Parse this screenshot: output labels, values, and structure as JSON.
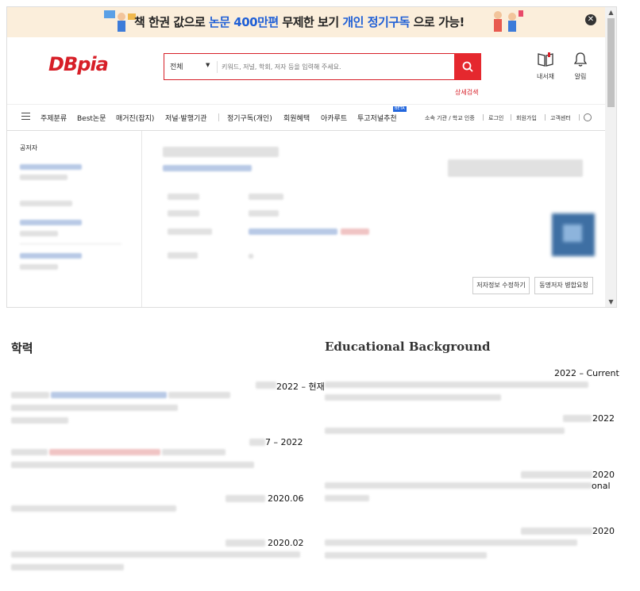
{
  "banner": {
    "text_prefix": "책 한권 값으로 ",
    "text_hl1": "논문 400만편",
    "text_mid": " 무제한 보기 ",
    "text_hl2": "개인 정기구독",
    "text_suffix": " 으로 가능!",
    "close_label": "✕"
  },
  "header": {
    "logo": "DBpia",
    "search_category": "전체",
    "search_placeholder": "키워드, 저널, 학회, 저자 등을 입력해 주세요.",
    "advanced_search": "상세검색",
    "my_library": "내서재",
    "notifications": "알림"
  },
  "nav": {
    "items": [
      "주제분류",
      "Best논문",
      "매거진(잡지)",
      "저널·발행기관",
      "정기구독(개인)",
      "회원혜택",
      "아카루트",
      "투고저널추천"
    ],
    "beta": "BETA",
    "utils": [
      "소속 기관 / 학교 인증",
      "로그인",
      "회원가입",
      "고객센터"
    ]
  },
  "sidebar": {
    "title": "공저자"
  },
  "author_buttons": {
    "edit": "저자정보 수정하기",
    "merge": "동명저자 병합요청"
  },
  "education_ko": {
    "title": "학력",
    "entries": [
      "2022 – 현재",
      "7 – 2022",
      "2020.06",
      "2020.02"
    ]
  },
  "education_en": {
    "title": "Educational Background",
    "entries": [
      "2022 – Current",
      "2022",
      "2020",
      "2020"
    ],
    "fragment": "onal"
  },
  "colors": {
    "brand_red": "#d71f28",
    "highlight_blue": "#1f5fd6",
    "banner_bg": "#fbeedb"
  }
}
